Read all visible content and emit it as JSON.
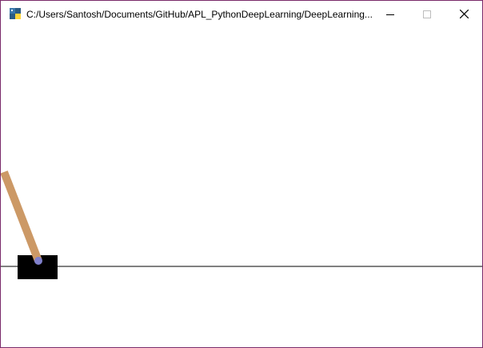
{
  "window": {
    "title": "C:/Users/Santosh/Documents/GitHub/APL_PythonDeepLearning/DeepLearning...",
    "app_icon": "python-icon",
    "controls": {
      "minimize_icon": "minimize-icon",
      "maximize_icon": "maximize-icon",
      "close_icon": "close-icon"
    }
  },
  "scene": {
    "environment": "cartpole",
    "colors": {
      "background": "#ffffff",
      "track": "#000000",
      "cart": "#000000",
      "pole": "#cc9966",
      "axle": "#8080cc"
    }
  }
}
